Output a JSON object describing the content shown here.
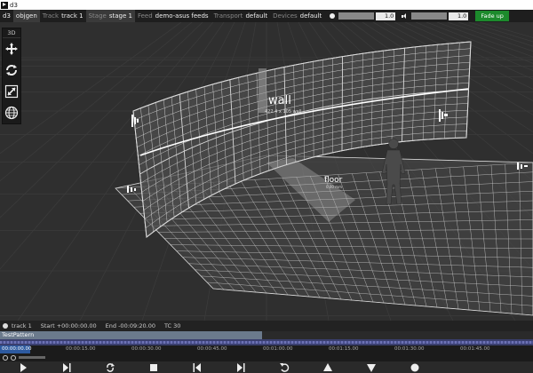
{
  "window": {
    "title": "d3"
  },
  "toolbar": {
    "app": "d3",
    "project": "objgen",
    "track_label": "Track",
    "track_value": "track 1",
    "stage_label": "Stage",
    "stage_value": "stage 1",
    "feed_label": "Feed",
    "feed_value": "demo-asus feeds",
    "transport_label": "Transport",
    "transport_value": "default",
    "devices_label": "Devices",
    "devices_value": "default",
    "brightness": {
      "icon": "sun-icon",
      "value": "1.0",
      "level": 1.0
    },
    "volume": {
      "icon": "speaker-icon",
      "value": "1.0",
      "level": 1.0
    },
    "fade_button": "Fade up",
    "fade_color": "#1c8a2c"
  },
  "tools": {
    "mode": "3D",
    "items": [
      "move-icon",
      "rotate-icon",
      "scale-icon",
      "globe-icon"
    ]
  },
  "scene": {
    "wall_label": "wall",
    "wall_sub": "422.4 x 105 wall",
    "floor_label": "floor",
    "floor_sub": "0.00 mm"
  },
  "timeline": {
    "track_name": "track 1",
    "start": "Start +00:00:00.00",
    "end": "End -00:09:20.00",
    "tc": "TC 30",
    "layer_name": "TestPattern",
    "layer_color": "#6b7a8c",
    "current_time": "00:00:00.00",
    "ticks": [
      "00:00:15.00",
      "00:00:30.00",
      "00:00:45.00",
      "00:01:00.00",
      "00:01:15.00",
      "00:01:30.00",
      "00:01:45.00"
    ]
  },
  "transport_buttons": [
    "play-icon",
    "play-to-end-icon",
    "loop-icon",
    "stop-icon",
    "prev-section-icon",
    "next-section-icon",
    "return-icon",
    "up-icon",
    "down-icon",
    "record-icon"
  ]
}
